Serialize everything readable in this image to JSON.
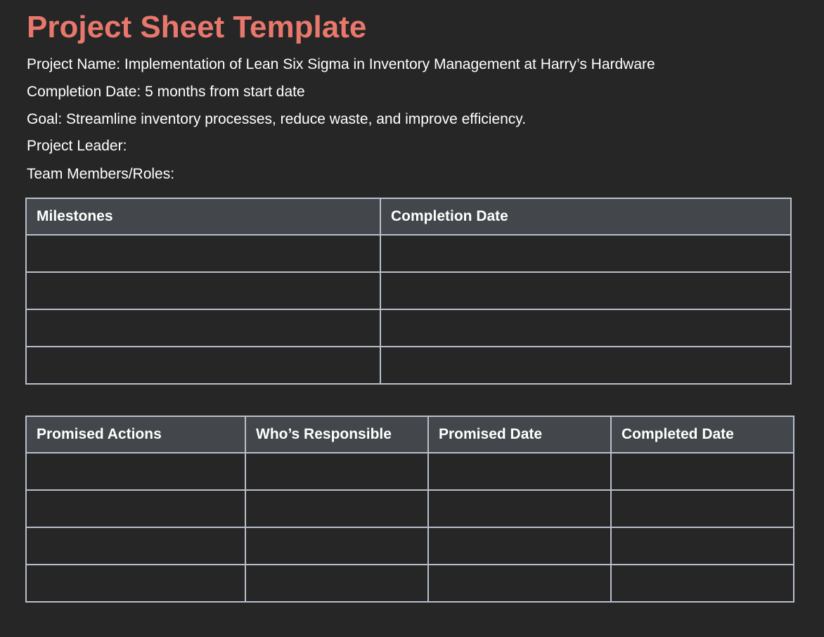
{
  "title": "Project Sheet Template",
  "info": {
    "project_name": "Project Name: Implementation of Lean Six Sigma in Inventory Management at Harry’s Hardware",
    "completion_date": "Completion Date: 5 months from start date",
    "goal": "Goal: Streamline inventory processes, reduce waste, and improve efficiency.",
    "project_leader": "Project Leader:",
    "team_members": "Team Members/Roles:"
  },
  "milestones_table": {
    "headers": [
      "Milestones",
      "Completion Date"
    ],
    "rows": [
      [
        "",
        ""
      ],
      [
        "",
        ""
      ],
      [
        "",
        ""
      ],
      [
        "",
        ""
      ]
    ]
  },
  "actions_table": {
    "headers": [
      "Promised Actions",
      "Who’s Responsible",
      "Promised Date",
      "Completed Date"
    ],
    "rows": [
      [
        "",
        "",
        "",
        ""
      ],
      [
        "",
        "",
        "",
        ""
      ],
      [
        "",
        "",
        "",
        ""
      ],
      [
        "",
        "",
        "",
        ""
      ]
    ]
  },
  "colors": {
    "background": "#262627",
    "title": "#e8776c",
    "header_fill": "#43474b",
    "border": "#b8c0cc",
    "text": "#ffffff"
  }
}
